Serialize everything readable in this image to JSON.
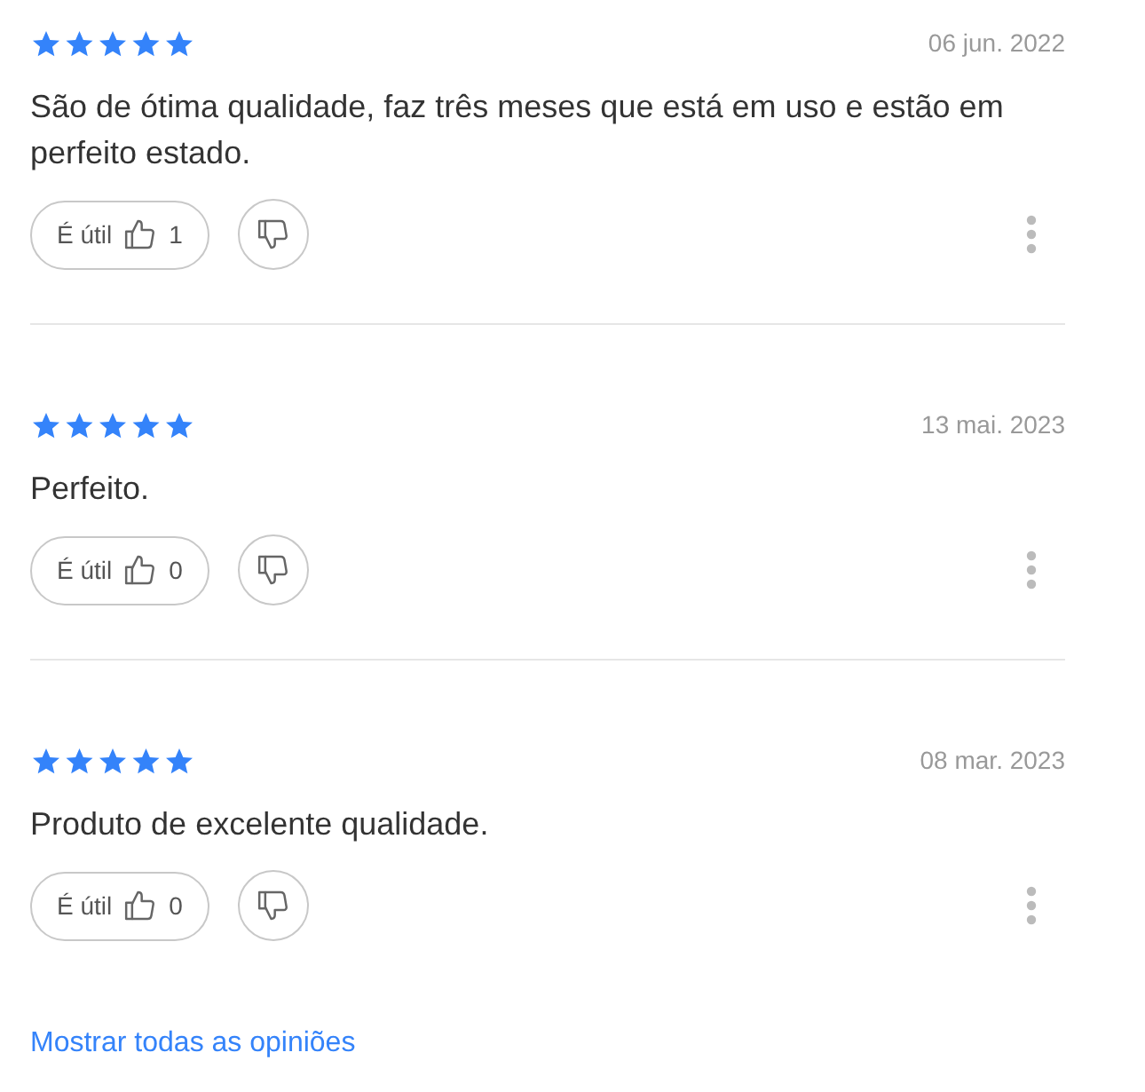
{
  "reviews": [
    {
      "stars": 5,
      "date": "06 jun. 2022",
      "text": "São de ótima qualidade, faz três meses que está em uso e estão em perfeito estado.",
      "helpful_label": "É útil",
      "helpful_count": "1"
    },
    {
      "stars": 5,
      "date": "13 mai. 2023",
      "text": "Perfeito.",
      "helpful_label": "É útil",
      "helpful_count": "0"
    },
    {
      "stars": 5,
      "date": "08 mar. 2023",
      "text": "Produto de excelente qualidade.",
      "helpful_label": "É útil",
      "helpful_count": "0"
    }
  ],
  "show_all_link": "Mostrar todas as opiniões"
}
